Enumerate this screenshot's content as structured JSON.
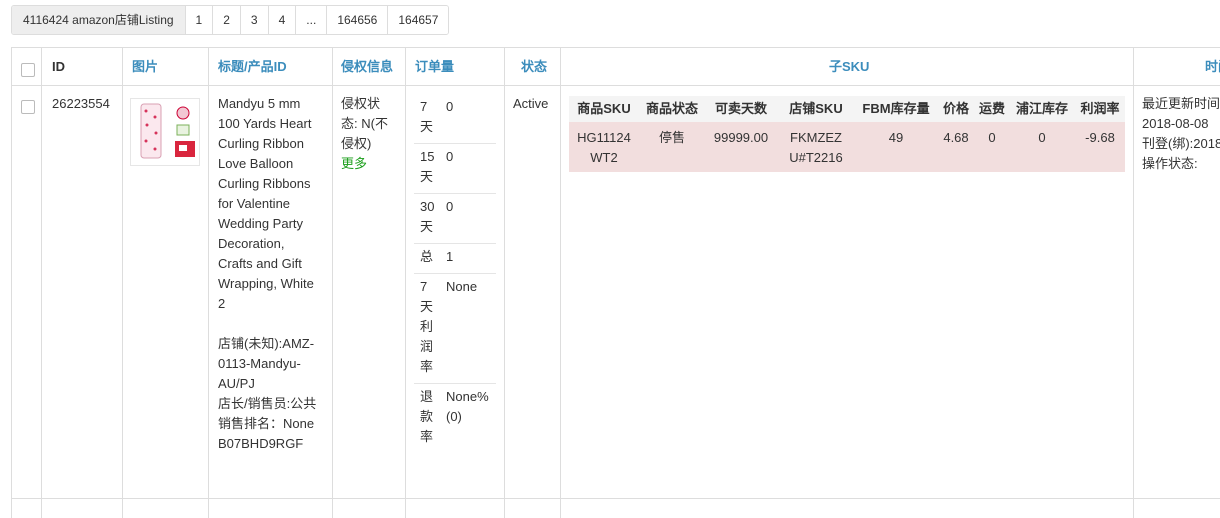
{
  "pagination": {
    "summary": "4116424 amazon店铺Listing",
    "pages": [
      "1",
      "2",
      "3",
      "4",
      "...",
      "164656",
      "164657"
    ]
  },
  "headers": {
    "id": "ID",
    "image": "图片",
    "title": "标题/产品ID",
    "infringement": "侵权信息",
    "orders": "订单量",
    "status": "状态",
    "child_sku": "子SKU",
    "time": "时间"
  },
  "row": {
    "id": "26223554",
    "title_lines": [
      "Mandyu 5 mm",
      "100 Yards Heart",
      "Curling Ribbon",
      "Love Balloon",
      "Curling Ribbons",
      "for Valentine",
      "Wedding Party",
      "Decoration,",
      "Crafts and Gift",
      "Wrapping, White",
      "2"
    ],
    "store_lines": [
      "店铺(未知):AMZ-",
      "0113-Mandyu-",
      "AU/PJ",
      "店长/销售员:公共",
      "销售排名：None",
      "B07BHD9RGF"
    ],
    "infringement_lines": [
      "侵权状",
      "态: N(不",
      "侵权)"
    ],
    "more_link": "更多",
    "orders": [
      {
        "k": [
          "7",
          "天"
        ],
        "v": "0"
      },
      {
        "k": [
          "15",
          "天"
        ],
        "v": "0"
      },
      {
        "k": [
          "30",
          "天"
        ],
        "v": "0"
      },
      {
        "k": [
          "总"
        ],
        "v": "1"
      },
      {
        "k": [
          "7",
          "天",
          "利",
          "润",
          "率"
        ],
        "v": "None"
      },
      {
        "k": [
          "退",
          "款",
          "率"
        ],
        "v": [
          "None%",
          "(0)"
        ]
      }
    ],
    "status": "Active",
    "sku_headers": [
      "商品SKU",
      "商品状态",
      "可卖天数",
      "店铺SKU",
      "FBM库存量",
      "价格",
      "运费",
      "浦江库存",
      "利润率"
    ],
    "sku_row": {
      "sku": [
        "HG11124",
        "WT2"
      ],
      "state": "停售",
      "days": "99999.00",
      "store_sku": [
        "FKMZEZ",
        "U#T2216"
      ],
      "fbm": "49",
      "price": "4.68",
      "shipping": "0",
      "pujiang": "0",
      "margin": "-9.68"
    },
    "time_lines": [
      "最近更新时间",
      "2018-08-08",
      "刊登(绑):2018",
      "操作状态:"
    ]
  },
  "colors": {
    "link": "#3c8dbc",
    "more": "#1a9e1a",
    "sku_row_bg": "#f2dede"
  }
}
